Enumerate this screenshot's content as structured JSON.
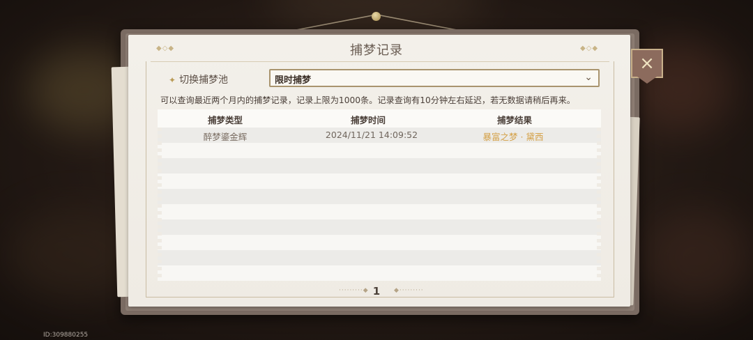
{
  "window": {
    "title": "捕梦记录",
    "close_icon": "×"
  },
  "ornaments": {
    "left": "◆◇◆",
    "right": "◆◇◆"
  },
  "pool": {
    "label": "切换捕梦池",
    "selected": "限时捕梦"
  },
  "notice": "可以查询最近两个月内的捕梦记录，记录上限为1000条。记录查询有10分钟左右延迟，若无数据请稍后再来。",
  "table": {
    "headers": [
      "捕梦类型",
      "捕梦时间",
      "捕梦结果"
    ],
    "rows": [
      {
        "type": "醉梦鎏金辉",
        "time": "2024/11/21 14:09:52",
        "result": "暴富之梦 · 黛西"
      }
    ],
    "result_color": "#d4a046"
  },
  "pagination": {
    "page": "1"
  },
  "uid": "ID:309880255"
}
